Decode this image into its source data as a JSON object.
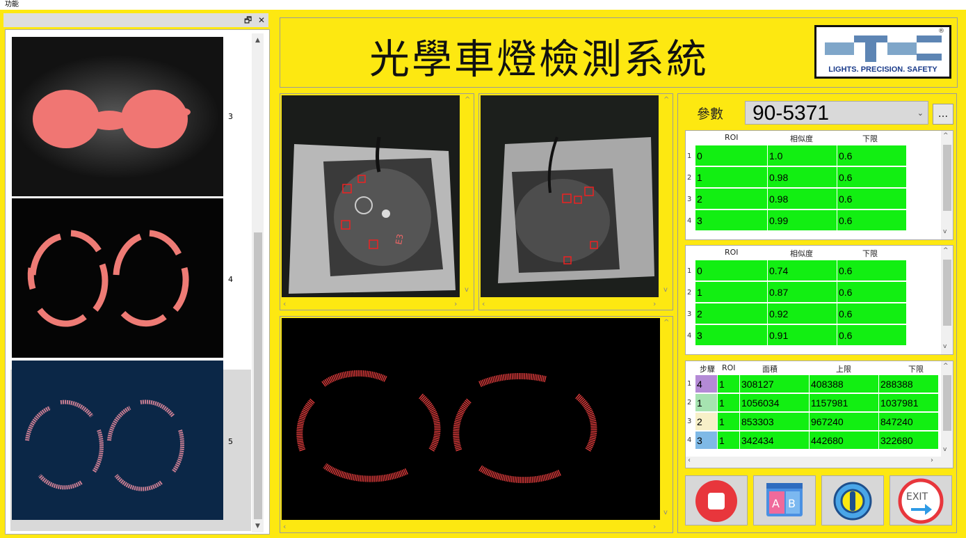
{
  "menu": {
    "label": "功能"
  },
  "dock": {
    "float_glyph": "🗗",
    "close_glyph": "✕"
  },
  "thumbnails": [
    {
      "label": "3"
    },
    {
      "label": "4"
    },
    {
      "label": "5"
    }
  ],
  "title": "光學車燈檢測系統",
  "logo": {
    "text": "LIGHTS. PRECISION. SAFETY",
    "reg": "®"
  },
  "params": {
    "label": "參數",
    "value": "90-5371",
    "more": "..."
  },
  "table1": {
    "headers": [
      "ROI",
      "相似度",
      "下限"
    ],
    "rows": [
      {
        "n": "1",
        "roi": "0",
        "sim": "1.0",
        "low": "0.6"
      },
      {
        "n": "2",
        "roi": "1",
        "sim": "0.98",
        "low": "0.6"
      },
      {
        "n": "3",
        "roi": "2",
        "sim": "0.98",
        "low": "0.6"
      },
      {
        "n": "4",
        "roi": "3",
        "sim": "0.99",
        "low": "0.6"
      }
    ]
  },
  "table2": {
    "headers": [
      "ROI",
      "相似度",
      "下限"
    ],
    "rows": [
      {
        "n": "1",
        "roi": "0",
        "sim": "0.74",
        "low": "0.6"
      },
      {
        "n": "2",
        "roi": "1",
        "sim": "0.87",
        "low": "0.6"
      },
      {
        "n": "3",
        "roi": "2",
        "sim": "0.92",
        "low": "0.6"
      },
      {
        "n": "4",
        "roi": "3",
        "sim": "0.91",
        "low": "0.6"
      }
    ]
  },
  "table3": {
    "headers": [
      "步驟",
      "ROI",
      "面積",
      "上限",
      "下限"
    ],
    "rows": [
      {
        "n": "1",
        "step": "4",
        "roi": "1",
        "area": "308127",
        "high": "408388",
        "low": "288388",
        "step_color": "#b48ad6"
      },
      {
        "n": "2",
        "step": "1",
        "roi": "1",
        "area": "1056034",
        "high": "1157981",
        "low": "1037981",
        "step_color": "#a6e3b0"
      },
      {
        "n": "3",
        "step": "2",
        "roi": "1",
        "area": "853303",
        "high": "967240",
        "low": "847240",
        "step_color": "#f7f0c8"
      },
      {
        "n": "4",
        "step": "3",
        "roi": "1",
        "area": "342434",
        "high": "442680",
        "low": "322680",
        "step_color": "#7fb9e6"
      }
    ]
  },
  "buttons": {
    "ab_a": "A",
    "ab_b": "B",
    "exit": "EXIT"
  },
  "colors": {
    "panel_bg": "#fde811",
    "pass_green": "#12ef12",
    "stop_red": "#e8363c"
  }
}
